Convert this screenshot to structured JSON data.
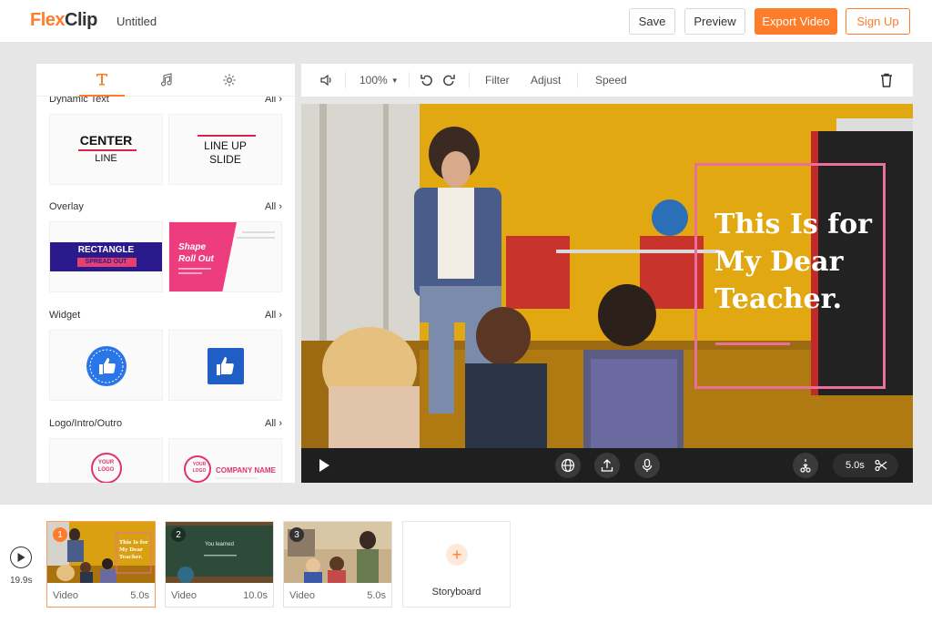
{
  "header": {
    "logo_flex": "Flex",
    "logo_clip": "Clip",
    "doc_title": "Untitled",
    "save_label": "Save",
    "preview_label": "Preview",
    "export_label": "Export Video",
    "signup_label": "Sign Up"
  },
  "panel": {
    "tabs": [
      "text-icon",
      "music-icon",
      "settings-icon"
    ],
    "sections": [
      {
        "title": "Dynamic Text",
        "all": "All"
      },
      {
        "title": "Overlay",
        "all": "All"
      },
      {
        "title": "Widget",
        "all": "All"
      },
      {
        "title": "Logo/Intro/Outro",
        "all": "All"
      }
    ],
    "cards": {
      "center_line_top": "CENTER",
      "center_line_bottom": "LINE",
      "line_up_top": "LINE UP",
      "line_up_bottom": "SLIDE",
      "rect_top": "RECTANGLE",
      "rect_bottom": "SPREAD OUT",
      "shape_top": "Shape",
      "shape_bottom": "Roll Out",
      "logo_your": "YOUR",
      "logo_logo": "LOGO",
      "company_name": "COMPANY NAME"
    }
  },
  "toolbar": {
    "zoom": "100%",
    "filter": "Filter",
    "adjust": "Adjust",
    "speed": "Speed"
  },
  "stage": {
    "overlay_line1": "This Is for",
    "overlay_line2": "My Dear",
    "overlay_line3": "Teacher."
  },
  "controls": {
    "duration": "5.0s"
  },
  "timeline": {
    "total": "19.9s",
    "clips": [
      {
        "num": "1",
        "kind": "Video",
        "dur": "5.0s",
        "thumb_text": "This Is for My Dear Teacher."
      },
      {
        "num": "2",
        "kind": "Video",
        "dur": "10.0s",
        "thumb_text": "You learned"
      },
      {
        "num": "3",
        "kind": "Video",
        "dur": "5.0s"
      }
    ],
    "storyboard_label": "Storyboard"
  },
  "colors": {
    "accent": "#ff7c2a",
    "overlay_pink": "#e8709a"
  }
}
